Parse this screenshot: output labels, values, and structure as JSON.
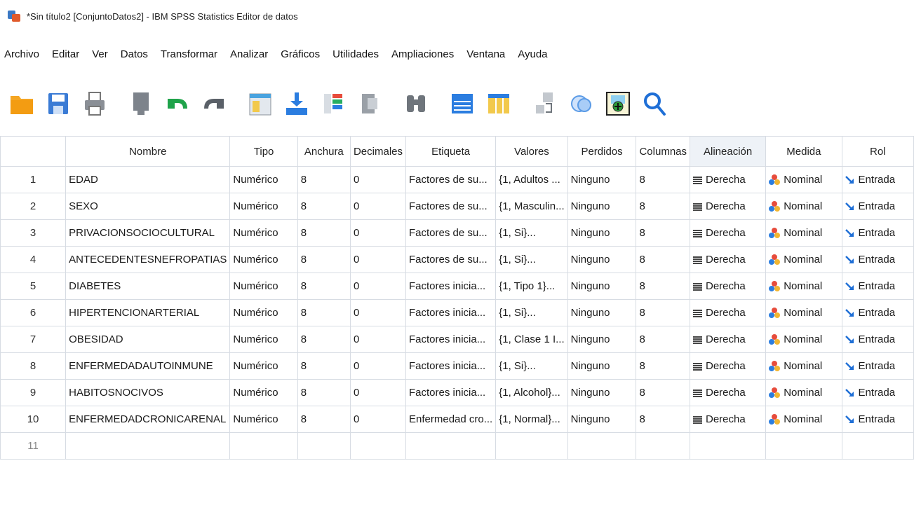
{
  "window": {
    "title": "*Sin título2 [ConjuntoDatos2] - IBM SPSS Statistics Editor de datos"
  },
  "menu": [
    "Archivo",
    "Editar",
    "Ver",
    "Datos",
    "Transformar",
    "Analizar",
    "Gráficos",
    "Utilidades",
    "Ampliaciones",
    "Ventana",
    "Ayuda"
  ],
  "toolbar": [
    "open-folder-icon",
    "save-icon",
    "print-icon",
    "dialog-recall-icon",
    "undo-icon",
    "redo-icon",
    "goto-case-icon",
    "goto-variable-icon",
    "variables-icon",
    "run-descriptives-icon",
    "find-icon",
    "insert-cases-icon",
    "insert-variable-icon",
    "split-file-icon",
    "weight-cases-icon",
    "select-cases-icon",
    "search-icon"
  ],
  "columns": [
    "Nombre",
    "Tipo",
    "Anchura",
    "Decimales",
    "Etiqueta",
    "Valores",
    "Perdidos",
    "Columnas",
    "Alineación",
    "Medida",
    "Rol"
  ],
  "rows": [
    {
      "n": "1",
      "name": "EDAD",
      "type": "Numérico",
      "width": "8",
      "dec": "0",
      "label": "Factores de su...",
      "values": "{1, Adultos ...",
      "missing": "Ninguno",
      "cols": "8",
      "align": "Derecha",
      "measure": "Nominal",
      "role": "Entrada"
    },
    {
      "n": "2",
      "name": "SEXO",
      "type": "Numérico",
      "width": "8",
      "dec": "0",
      "label": "Factores de su...",
      "values": "{1, Masculin...",
      "missing": "Ninguno",
      "cols": "8",
      "align": "Derecha",
      "measure": "Nominal",
      "role": "Entrada"
    },
    {
      "n": "3",
      "name": "PRIVACIONSOCIOCULTURAL",
      "type": "Numérico",
      "width": "8",
      "dec": "0",
      "label": "Factores de su...",
      "values": "{1, Si}...",
      "missing": "Ninguno",
      "cols": "8",
      "align": "Derecha",
      "measure": "Nominal",
      "role": "Entrada"
    },
    {
      "n": "4",
      "name": "ANTECEDENTESNEFROPATIAS",
      "type": "Numérico",
      "width": "8",
      "dec": "0",
      "label": "Factores de su...",
      "values": "{1, Si}...",
      "missing": "Ninguno",
      "cols": "8",
      "align": "Derecha",
      "measure": "Nominal",
      "role": "Entrada"
    },
    {
      "n": "5",
      "name": "DIABETES",
      "type": "Numérico",
      "width": "8",
      "dec": "0",
      "label": "Factores inicia...",
      "values": "{1, Tipo 1}...",
      "missing": "Ninguno",
      "cols": "8",
      "align": "Derecha",
      "measure": "Nominal",
      "role": "Entrada"
    },
    {
      "n": "6",
      "name": "HIPERTENCIONARTERIAL",
      "type": "Numérico",
      "width": "8",
      "dec": "0",
      "label": "Factores inicia...",
      "values": "{1, Si}...",
      "missing": "Ninguno",
      "cols": "8",
      "align": "Derecha",
      "measure": "Nominal",
      "role": "Entrada"
    },
    {
      "n": "7",
      "name": "OBESIDAD",
      "type": "Numérico",
      "width": "8",
      "dec": "0",
      "label": "Factores inicia...",
      "values": "{1, Clase 1 I...",
      "missing": "Ninguno",
      "cols": "8",
      "align": "Derecha",
      "measure": "Nominal",
      "role": "Entrada"
    },
    {
      "n": "8",
      "name": "ENFERMEDADAUTOINMUNE",
      "type": "Numérico",
      "width": "8",
      "dec": "0",
      "label": "Factores inicia...",
      "values": "{1, Si}...",
      "missing": "Ninguno",
      "cols": "8",
      "align": "Derecha",
      "measure": "Nominal",
      "role": "Entrada"
    },
    {
      "n": "9",
      "name": "HABITOSNOCIVOS",
      "type": "Numérico",
      "width": "8",
      "dec": "0",
      "label": "Factores inicia...",
      "values": "{1, Alcohol}...",
      "missing": "Ninguno",
      "cols": "8",
      "align": "Derecha",
      "measure": "Nominal",
      "role": "Entrada"
    },
    {
      "n": "10",
      "name": "ENFERMEDADCRONICARENAL",
      "type": "Numérico",
      "width": "8",
      "dec": "0",
      "label": "Enfermedad cro...",
      "values": "{1, Normal}...",
      "missing": "Ninguno",
      "cols": "8",
      "align": "Derecha",
      "measure": "Nominal",
      "role": "Entrada"
    }
  ],
  "empty_row": {
    "n": "11"
  }
}
